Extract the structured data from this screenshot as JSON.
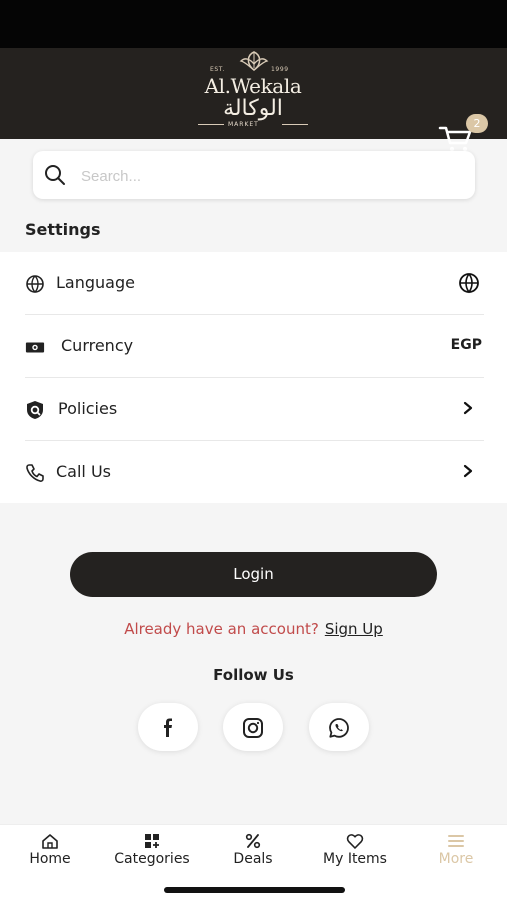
{
  "header": {
    "brand": {
      "est": "EST.",
      "year": "1999",
      "latin_name": "Al.Wekala",
      "arabic_name": "الوكالة",
      "tagline": "MARKET"
    },
    "cart": {
      "icon": "cart-icon",
      "badge_count": "2",
      "badge_color": "#dbc7a6"
    }
  },
  "search": {
    "placeholder": "Search...",
    "icon": "search-icon"
  },
  "settings": {
    "title": "Settings",
    "items": [
      {
        "label": "Language",
        "icon": "language-icon",
        "trailing": "globe-icon"
      },
      {
        "label": "Currency",
        "icon": "currency-icon",
        "trailing_text": "EGP"
      },
      {
        "label": "Policies",
        "icon": "shield-icon",
        "trailing": "chevron-right-icon"
      },
      {
        "label": "Call Us",
        "icon": "phone-icon",
        "trailing": "chevron-right-icon"
      }
    ]
  },
  "account": {
    "login_label": "Login",
    "already_text": "Already have an account?",
    "signup_label": "Sign Up"
  },
  "social": {
    "follow_label": "Follow Us",
    "items": [
      "facebook-icon",
      "instagram-icon",
      "whatsapp-icon"
    ]
  },
  "bottom_nav": {
    "items": [
      {
        "label": "Home",
        "icon": "home-icon"
      },
      {
        "label": "Categories",
        "icon": "categories-icon"
      },
      {
        "label": "Deals",
        "icon": "percent-icon"
      },
      {
        "label": "My Items",
        "icon": "heart-icon"
      },
      {
        "label": "More",
        "icon": "menu-icon",
        "active": true
      }
    ]
  },
  "colors": {
    "header_bg": "#25221f",
    "accent": "#dbc7a6",
    "account_prompt": "#c14b4b",
    "login_button": "#242220"
  }
}
